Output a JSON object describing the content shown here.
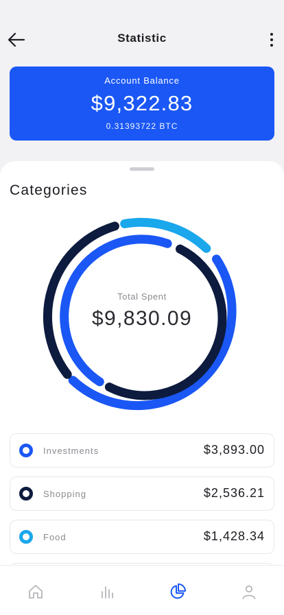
{
  "header": {
    "title": "Statistic",
    "back_icon": "arrow-left-icon",
    "menu_icon": "more-vertical-icon"
  },
  "balance": {
    "label": "Account Balance",
    "value": "$9,322.83",
    "btc": "0.31393722 BTC",
    "color": "#1a57f5"
  },
  "categories_section": {
    "title": "Categories",
    "total_label": "Total Spent",
    "total_value": "$9,830.09"
  },
  "categories": [
    {
      "name": "Investments",
      "amount": "$3,893.00",
      "color": "#1a57f5"
    },
    {
      "name": "Shopping",
      "amount": "$2,536.21",
      "color": "#0d1b3e"
    },
    {
      "name": "Food",
      "amount": "$1,428.34",
      "color": "#1aa7ec"
    }
  ],
  "nav": [
    {
      "name": "home",
      "icon": "home-icon",
      "active": false
    },
    {
      "name": "stats",
      "icon": "bar-chart-icon",
      "active": false
    },
    {
      "name": "categories",
      "icon": "pie-chart-icon",
      "active": true
    },
    {
      "name": "profile",
      "icon": "user-icon",
      "active": false
    }
  ],
  "colors": {
    "accent": "#1a57f5",
    "dark": "#0d1b3e",
    "light_blue": "#1aa7ec",
    "inactive_icon": "#b5b5bb"
  }
}
